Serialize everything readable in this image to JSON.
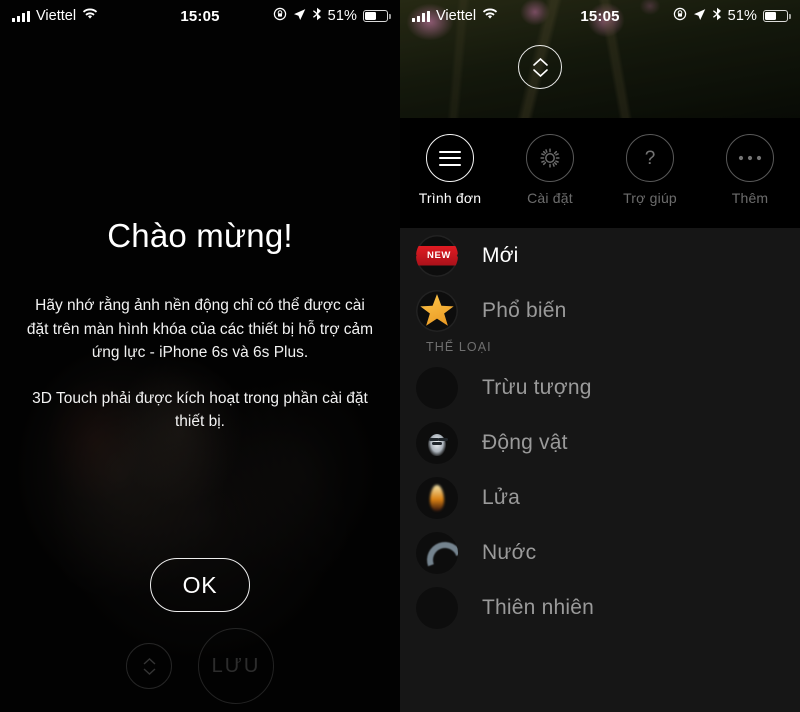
{
  "status_bar": {
    "carrier": "Viettel",
    "time": "15:05",
    "battery_percent": "51%",
    "icons": [
      "signal-bars-icon",
      "wifi-icon",
      "rotation-lock-icon",
      "location-arrow-icon",
      "bluetooth-icon",
      "battery-icon"
    ]
  },
  "left_screen": {
    "welcome_title": "Chào mừng!",
    "welcome_body_1": "Hãy nhớ rằng ảnh nền động chỉ có thể được cài đặt trên màn hình khóa của các thiết bị hỗ trợ cảm ứng lực - iPhone 6s và 6s Plus.",
    "welcome_body_2": "3D Touch phải được kích hoạt trong phần cài đặt thiết bị.",
    "ok_button": "OK",
    "save_button": "LƯU",
    "expand_icon": "chevron-up-down-icon"
  },
  "right_screen": {
    "expand_icon": "chevron-up-down-icon",
    "toolbar": [
      {
        "label": "Trình đơn",
        "icon": "hamburger-menu-icon",
        "active": true
      },
      {
        "label": "Cài đặt",
        "icon": "gear-icon",
        "active": false
      },
      {
        "label": "Trợ giúp",
        "icon": "question-mark-icon",
        "active": false
      },
      {
        "label": "Thêm",
        "icon": "ellipsis-icon",
        "active": false
      }
    ],
    "list": {
      "top_items": [
        {
          "label": "Mới",
          "icon": "new-ribbon-badge-icon",
          "selected": true
        },
        {
          "label": "Phổ biến",
          "icon": "star-icon",
          "selected": false
        }
      ],
      "section_header": "THỂ LOẠI",
      "categories": [
        {
          "label": "Trừu tượng",
          "icon": "abstract-swirl-icon"
        },
        {
          "label": "Động vật",
          "icon": "tiger-face-icon"
        },
        {
          "label": "Lửa",
          "icon": "flame-icon"
        },
        {
          "label": "Nước",
          "icon": "water-wave-icon"
        },
        {
          "label": "Thiên nhiên",
          "icon": "foliage-icon"
        }
      ]
    },
    "badge_text": "NEW"
  },
  "colors": {
    "accent_red": "#d6161d",
    "star_gold": "#f0a720",
    "list_bg": "#161616",
    "screen_bg": "#000000"
  }
}
